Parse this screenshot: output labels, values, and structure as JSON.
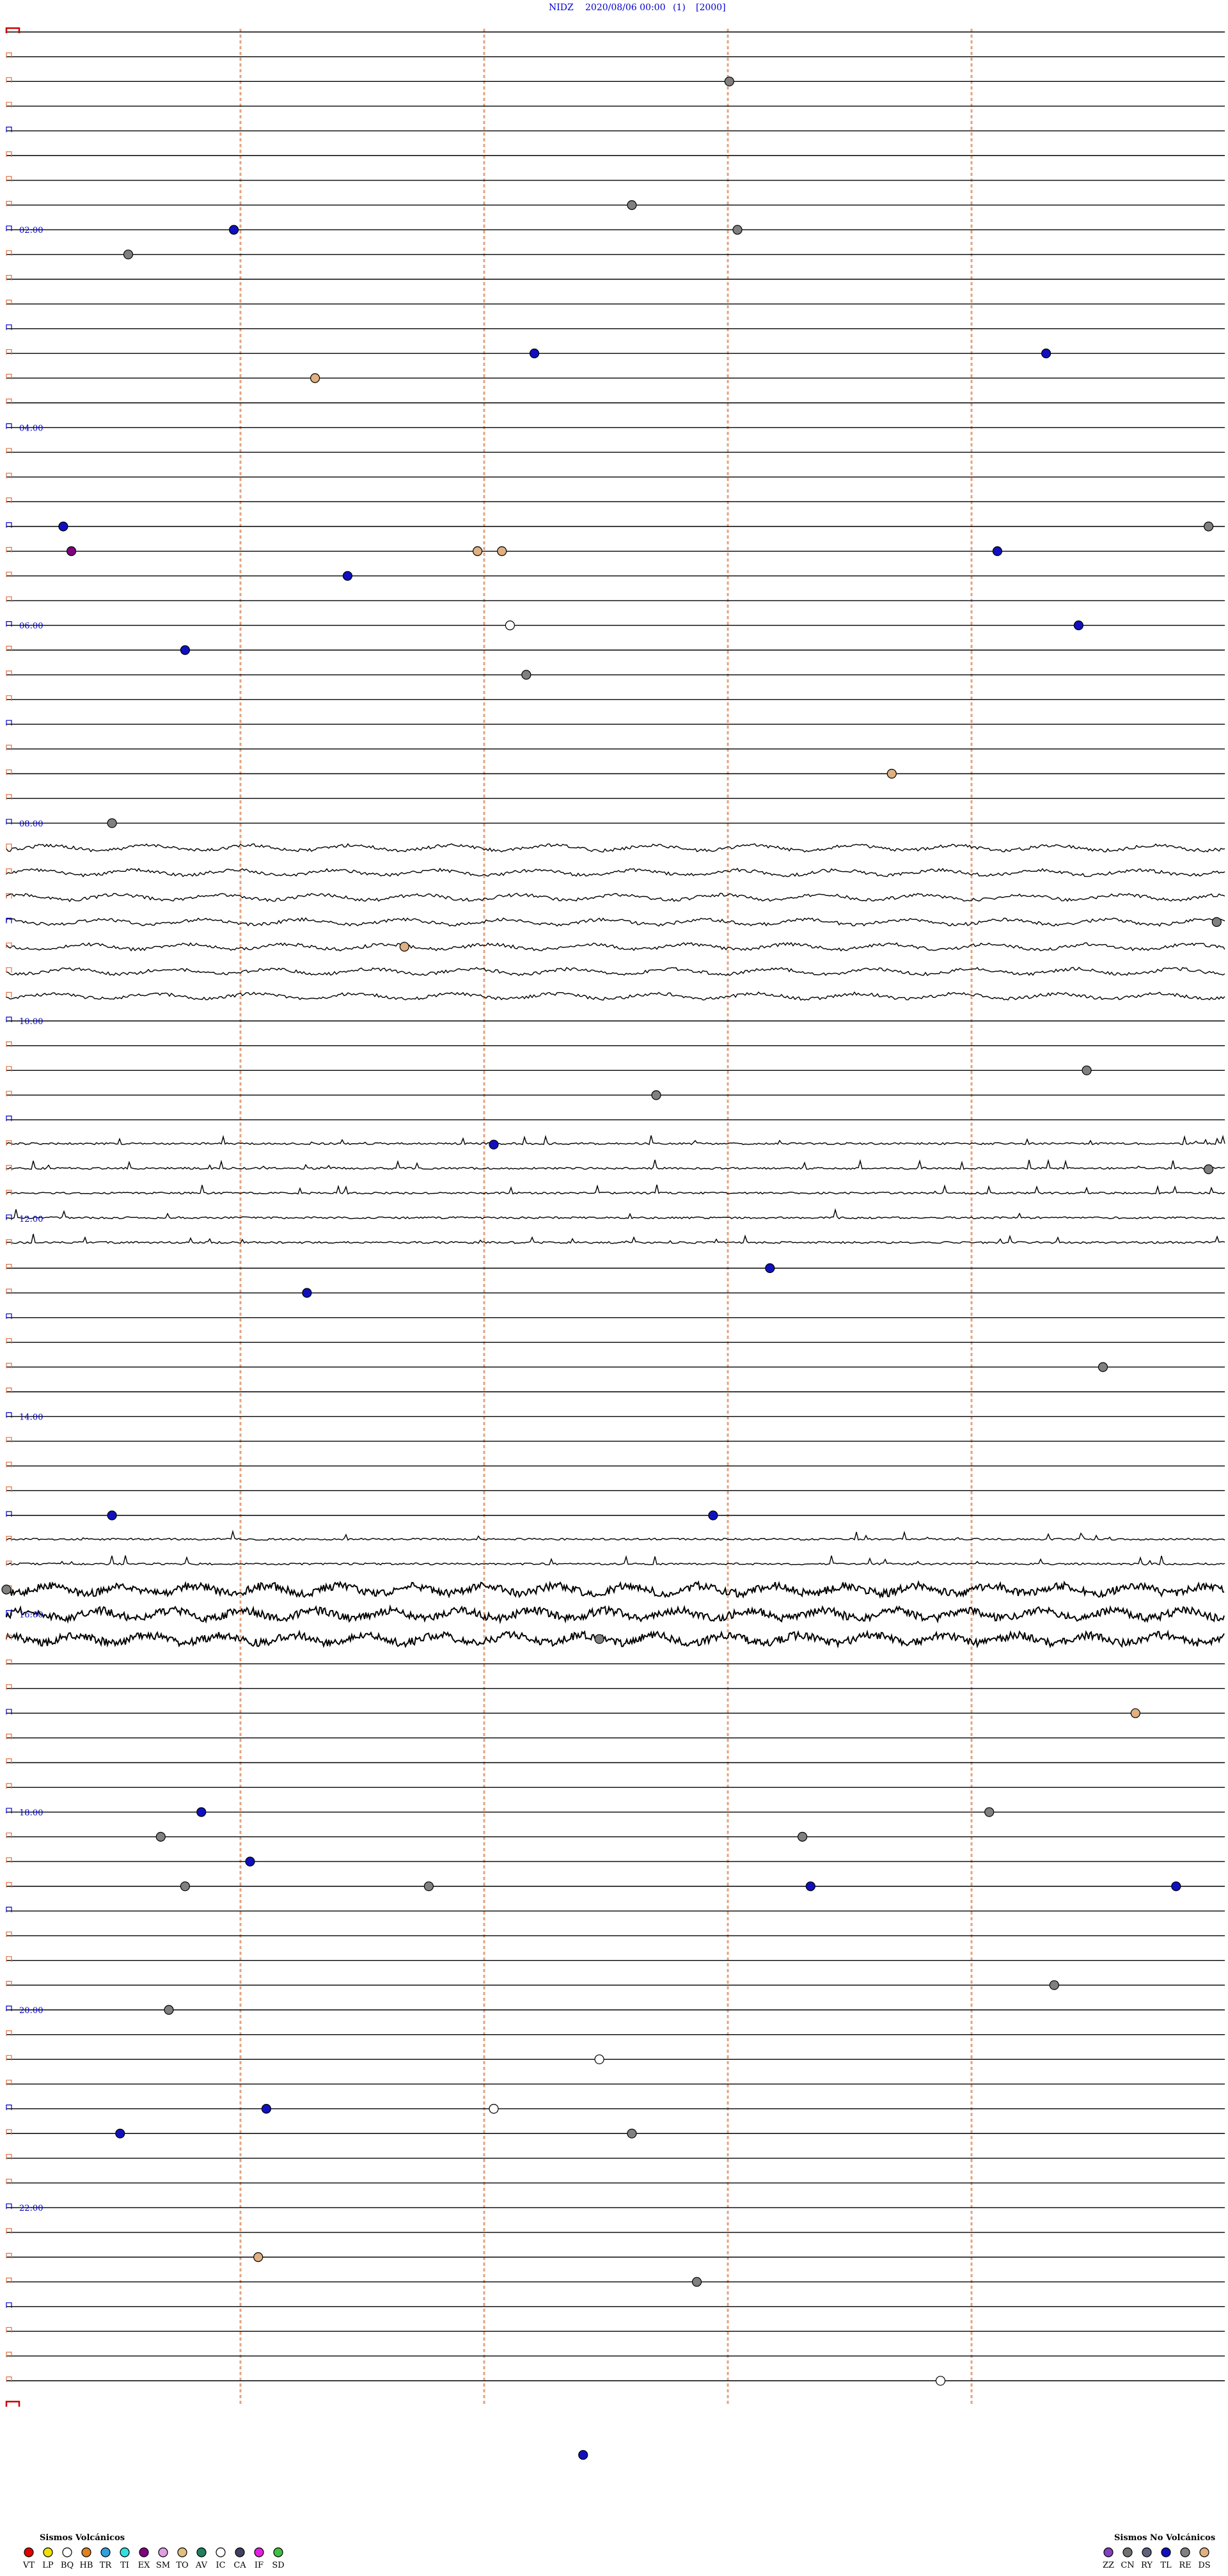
{
  "header": {
    "station": "NIDZ",
    "datetime": "2020/08/06 00:00",
    "count": "(1)",
    "scale": "[2000]"
  },
  "colors": {
    "title": "#0000cc",
    "trace": "#000000",
    "marker_line": "#e0956a",
    "bracket_blue": "#0000cc",
    "bracket_red": "#cc0000"
  },
  "chart_data": {
    "type": "scatter",
    "description_type": "helicorder",
    "x_unit": "minutes within 15-minute line",
    "y_unit": "hour of day",
    "line_minutes": 15,
    "lines": 96,
    "x_range": [
      0,
      15
    ],
    "hour_labels": [
      "02:00",
      "04:00",
      "06:00",
      "08:00",
      "10:00",
      "12:00",
      "14:00",
      "16:00",
      "18:00",
      "20:00",
      "22:00"
    ],
    "event_colors": {
      "VT": "#e00000",
      "LP": "#f0e000",
      "BQ": "#ffffff",
      "HB": "#e08020",
      "TR": "#30a0e0",
      "TI": "#30e0e0",
      "EX": "#800080",
      "SM": "#e0a0e0",
      "TO": "#e0c080",
      "AV": "#208060",
      "IC": "#ffffff",
      "CA": "#404060",
      "IF": "#e020e0",
      "SD": "#40c040",
      "ZZ": "#8040c0",
      "CN": "#707070",
      "RY": "#606080",
      "TL": "#1010c0",
      "RE": "#808080",
      "DS": "#e0b080"
    },
    "events": [
      {
        "h": 0.5,
        "m": 8.9,
        "type": "RE"
      },
      {
        "h": 1.75,
        "m": 7.7,
        "type": "RE"
      },
      {
        "h": 1.75,
        "m": 24.0,
        "type": "RE"
      },
      {
        "h": 2.0,
        "m": 2.8,
        "type": "TL"
      },
      {
        "h": 2.25,
        "m": 1.5,
        "type": "RE"
      },
      {
        "h": 3.25,
        "m": 6.5,
        "type": "TL"
      },
      {
        "h": 3.25,
        "m": 12.8,
        "type": "TL"
      },
      {
        "h": 3.5,
        "m": 3.8,
        "type": "DS"
      },
      {
        "h": 5.0,
        "m": 0.7,
        "type": "TL"
      },
      {
        "h": 5.0,
        "m": 14.8,
        "type": "RE"
      },
      {
        "h": 5.25,
        "m": 0.8,
        "type": "EX"
      },
      {
        "h": 5.25,
        "m": 5.8,
        "type": "DS"
      },
      {
        "h": 5.25,
        "m": 6.1,
        "type": "DS"
      },
      {
        "h": 5.25,
        "m": 12.2,
        "type": "TL"
      },
      {
        "h": 5.5,
        "m": 4.2,
        "type": "TL"
      },
      {
        "h": 6.0,
        "m": 6.2,
        "type": "BQ"
      },
      {
        "h": 6.0,
        "m": 13.2,
        "type": "TL"
      },
      {
        "h": 6.25,
        "m": 2.2,
        "type": "TL"
      },
      {
        "h": 6.5,
        "m": 6.4,
        "type": "RE"
      },
      {
        "h": 7.5,
        "m": 10.9,
        "type": "DS"
      },
      {
        "h": 8.0,
        "m": 1.3,
        "type": "RE"
      },
      {
        "h": 9.0,
        "m": 14.9,
        "type": "RE"
      },
      {
        "h": 9.25,
        "m": 4.9,
        "type": "DS"
      },
      {
        "h": 10.5,
        "m": 13.3,
        "type": "RE"
      },
      {
        "h": 10.75,
        "m": 8.0,
        "type": "RE"
      },
      {
        "h": 11.25,
        "m": 6.0,
        "type": "TL"
      },
      {
        "h": 11.5,
        "m": 14.8,
        "type": "RE"
      },
      {
        "h": 12.5,
        "m": 9.4,
        "type": "TL"
      },
      {
        "h": 12.75,
        "m": 3.7,
        "type": "TL"
      },
      {
        "h": 13.5,
        "m": 13.5,
        "type": "RE"
      },
      {
        "h": 15.0,
        "m": 1.3,
        "type": "TL"
      },
      {
        "h": 15.0,
        "m": 8.7,
        "type": "TL"
      },
      {
        "h": 15.75,
        "m": 0.0,
        "type": "RE"
      },
      {
        "h": 16.25,
        "m": 7.3,
        "type": "RE"
      },
      {
        "h": 17.0,
        "m": 13.9,
        "type": "DS"
      },
      {
        "h": 18.0,
        "m": 2.4,
        "type": "TL"
      },
      {
        "h": 18.0,
        "m": 12.1,
        "type": "RE"
      },
      {
        "h": 18.0,
        "m": 16.9,
        "type": "RE"
      },
      {
        "h": 18.25,
        "m": 9.8,
        "type": "RE"
      },
      {
        "h": 18.5,
        "m": 3.0,
        "type": "TL"
      },
      {
        "h": 18.5,
        "m": 17.2,
        "type": "RE"
      },
      {
        "h": 18.5,
        "m": 20.2,
        "type": "RE"
      },
      {
        "h": 18.75,
        "m": 9.9,
        "type": "TL"
      },
      {
        "h": 18.75,
        "m": 14.4,
        "type": "TL"
      },
      {
        "h": 19.75,
        "m": 12.9,
        "type": "RE"
      },
      {
        "h": 20.0,
        "m": 2.0,
        "type": "RE"
      },
      {
        "h": 20.5,
        "m": 7.3,
        "type": "BQ"
      },
      {
        "h": 21.0,
        "m": 3.2,
        "type": "TL"
      },
      {
        "h": 21.0,
        "m": 6.0,
        "type": "BQ"
      },
      {
        "h": 21.0,
        "m": 22.7,
        "type": "RE"
      },
      {
        "h": 21.0,
        "m": 16.4,
        "type": "TL"
      },
      {
        "h": 22.5,
        "m": 3.1,
        "type": "DS"
      },
      {
        "h": 22.5,
        "m": 23.5,
        "type": "RE"
      },
      {
        "h": 23.75,
        "m": 11.5,
        "type": "BQ"
      },
      {
        "h": 24.25,
        "m": 22.1,
        "type": "TL"
      }
    ]
  },
  "legend": {
    "volcanic_title": "Sismos Volcánicos",
    "volcanic_items": [
      "VT",
      "LP",
      "BQ",
      "HB",
      "TR",
      "TI",
      "EX",
      "SM",
      "TO",
      "AV",
      "IC",
      "CA",
      "IF",
      "SD"
    ],
    "nonvolcanic_title": "Sismos No Volcánicos",
    "nonvolcanic_items": [
      "ZZ",
      "CN",
      "RY",
      "TL",
      "RE",
      "DS"
    ]
  }
}
